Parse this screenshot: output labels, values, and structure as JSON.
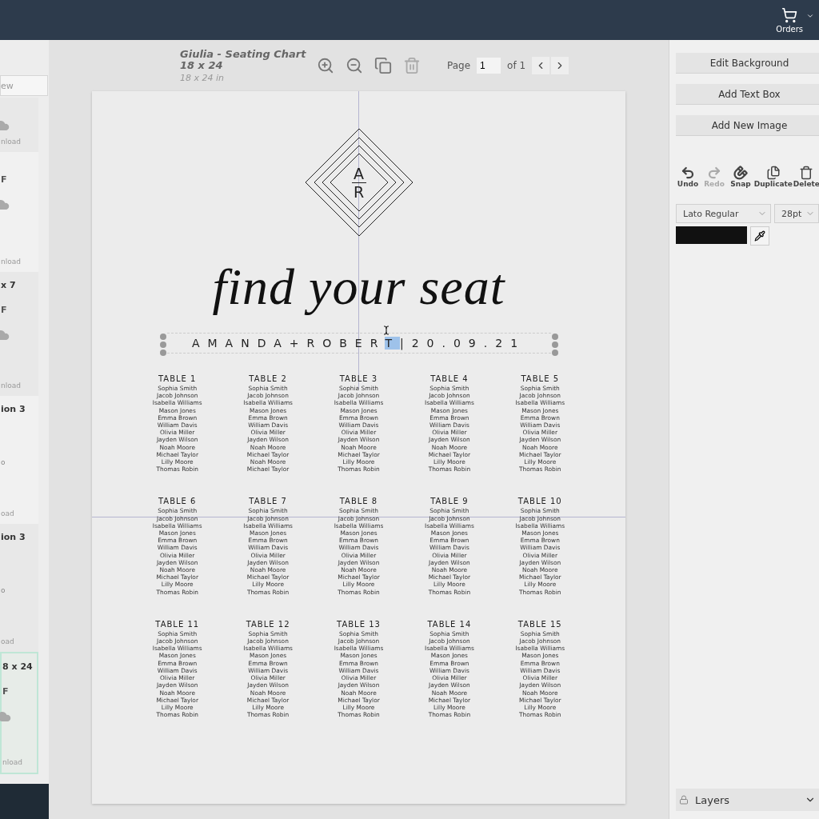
{
  "header": {
    "orders_label": "Orders"
  },
  "sidebar": {
    "search_text": "ew",
    "cards": [
      {
        "action": "nload",
        "cloud": true,
        "selected": false
      },
      {
        "format": "F",
        "action": "nload",
        "cloud": true,
        "selected": false
      },
      {
        "title": "x 7",
        "format": "F",
        "action": "nload",
        "cloud": true,
        "selected": false
      },
      {
        "title": "ion 3",
        "note": "o",
        "action": "oad",
        "cloud": false,
        "selected": false
      },
      {
        "title": "ion 3",
        "note": "o",
        "action": "oad",
        "cloud": false,
        "selected": false
      },
      {
        "title": "8 x 24",
        "format": "F",
        "action": "nload",
        "cloud": true,
        "selected": true
      }
    ]
  },
  "toolbar": {
    "document_title": "Giulia - Seating Chart 18 x 24",
    "document_size": "18 x 24 in",
    "page_label": "Page",
    "page_value": "1",
    "page_total": "of 1"
  },
  "chart": {
    "monogram": {
      "top": "A",
      "bottom": "R"
    },
    "headline": "find your seat",
    "subtitle": {
      "before": "AMANDA+ROBER",
      "selected": "T",
      "after": "|20.09.21"
    },
    "tables": [
      {
        "name": "TABLE 1",
        "guests": [
          "Sophia Smith",
          "Jacob Johnson",
          "Isabella Williams",
          "Mason Jones",
          "Emma Brown",
          "William Davis",
          "Olivia Miller",
          "Jayden Wilson",
          "Noah Moore",
          "Michael Taylor",
          "Lilly Moore",
          "Thomas Robin"
        ]
      },
      {
        "name": "TABLE 2",
        "guests": [
          "Sophia Smith",
          "Jacob Johnson",
          "Isabella Williams",
          "Mason Jones",
          "Emma Brown",
          "William Davis",
          "Olivia Miller",
          "Jayden Wilson",
          "Noah Moore",
          "Michael Taylor",
          "Noah Moore",
          "Michael Taylor"
        ]
      },
      {
        "name": "TABLE 3",
        "guests": [
          "Sophia Smith",
          "Jacob Johnson",
          "Isabella Williams",
          "Mason Jones",
          "Emma Brown",
          "William Davis",
          "Olivia Miller",
          "Jayden Wilson",
          "Noah Moore",
          "Michael Taylor",
          "Lilly Moore",
          "Thomas Robin"
        ]
      },
      {
        "name": "TABLE 4",
        "guests": [
          "Sophia Smith",
          "Jacob Johnson",
          "Isabella Williams",
          "Mason Jones",
          "Emma Brown",
          "William Davis",
          "Olivia Miller",
          "Jayden Wilson",
          "Noah Moore",
          "Michael Taylor",
          "Lilly Moore",
          "Thomas Robin"
        ]
      },
      {
        "name": "TABLE 5",
        "guests": [
          "Sophia Smith",
          "Jacob Johnson",
          "Isabella Williams",
          "Mason Jones",
          "Emma Brown",
          "William Davis",
          "Olivia Miller",
          "Jayden Wilson",
          "Noah Moore",
          "Michael Taylor",
          "Lilly Moore",
          "Thomas Robin"
        ]
      },
      {
        "name": "TABLE 6",
        "guests": [
          "Sophia Smith",
          "Jacob Johnson",
          "Isabella Williams",
          "Mason Jones",
          "Emma Brown",
          "William Davis",
          "Olivia Miller",
          "Jayden Wilson",
          "Noah Moore",
          "Michael Taylor",
          "Lilly Moore",
          "Thomas Robin"
        ]
      },
      {
        "name": "TABLE 7",
        "guests": [
          "Sophia Smith",
          "Jacob Johnson",
          "Isabella Williams",
          "Mason Jones",
          "Emma Brown",
          "William Davis",
          "Olivia Miller",
          "Jayden Wilson",
          "Noah Moore",
          "Michael Taylor",
          "Lilly Moore",
          "Thomas Robin"
        ]
      },
      {
        "name": "TABLE 8",
        "guests": [
          "Sophia Smith",
          "Jacob Johnson",
          "Isabella Williams",
          "Mason Jones",
          "Emma Brown",
          "William Davis",
          "Olivia Miller",
          "Jayden Wilson",
          "Noah Moore",
          "Michael Taylor",
          "Lilly Moore",
          "Thomas Robin"
        ]
      },
      {
        "name": "TABLE 9",
        "guests": [
          "Sophia Smith",
          "Jacob Johnson",
          "Isabella Williams",
          "Mason Jones",
          "Emma Brown",
          "William Davis",
          "Olivia Miller",
          "Jayden Wilson",
          "Noah Moore",
          "Michael Taylor",
          "Lilly Moore",
          "Thomas Robin"
        ]
      },
      {
        "name": "TABLE 10",
        "guests": [
          "Sophia Smith",
          "Jacob Johnson",
          "Isabella Williams",
          "Mason Jones",
          "Emma Brown",
          "William Davis",
          "Olivia Miller",
          "Jayden Wilson",
          "Noah Moore",
          "Michael Taylor",
          "Lilly Moore",
          "Thomas Robin"
        ]
      },
      {
        "name": "TABLE 11",
        "guests": [
          "Sophia Smith",
          "Jacob Johnson",
          "Isabella Williams",
          "Mason Jones",
          "Emma Brown",
          "William Davis",
          "Olivia Miller",
          "Jayden Wilson",
          "Noah Moore",
          "Michael Taylor",
          "Lilly Moore",
          "Thomas Robin"
        ]
      },
      {
        "name": "TABLE 12",
        "guests": [
          "Sophia Smith",
          "Jacob Johnson",
          "Isabella Williams",
          "Mason Jones",
          "Emma Brown",
          "William Davis",
          "Olivia Miller",
          "Jayden Wilson",
          "Noah Moore",
          "Michael Taylor",
          "Lilly Moore",
          "Thomas Robin"
        ]
      },
      {
        "name": "TABLE 13",
        "guests": [
          "Sophia Smith",
          "Jacob Johnson",
          "Isabella Williams",
          "Mason Jones",
          "Emma Brown",
          "William Davis",
          "Olivia Miller",
          "Jayden Wilson",
          "Noah Moore",
          "Michael Taylor",
          "Lilly Moore",
          "Thomas Robin"
        ]
      },
      {
        "name": "TABLE 14",
        "guests": [
          "Sophia Smith",
          "Jacob Johnson",
          "Isabella Williams",
          "Mason Jones",
          "Emma Brown",
          "William Davis",
          "Olivia Miller",
          "Jayden Wilson",
          "Noah Moore",
          "Michael Taylor",
          "Lilly Moore",
          "Thomas Robin"
        ]
      },
      {
        "name": "TABLE 15",
        "guests": [
          "Sophia Smith",
          "Jacob Johnson",
          "Isabella Williams",
          "Mason Jones",
          "Emma Brown",
          "William Davis",
          "Olivia Miller",
          "Jayden Wilson",
          "Noah Moore",
          "Michael Taylor",
          "Lilly Moore",
          "Thomas Robin"
        ]
      }
    ]
  },
  "panel": {
    "buttons": [
      "Edit Background",
      "Add Text Box",
      "Add New Image"
    ],
    "tools": [
      {
        "kind": "undo",
        "label": "Undo",
        "disabled": false
      },
      {
        "kind": "redo",
        "label": "Redo",
        "disabled": true
      },
      {
        "kind": "snap",
        "label": "Snap",
        "disabled": false
      },
      {
        "kind": "duplicate",
        "label": "Duplicate",
        "disabled": false
      },
      {
        "kind": "delete",
        "label": "Delete",
        "disabled": false
      }
    ],
    "font": "Lato Regular",
    "size": "28pt",
    "layers_label": "Layers"
  }
}
